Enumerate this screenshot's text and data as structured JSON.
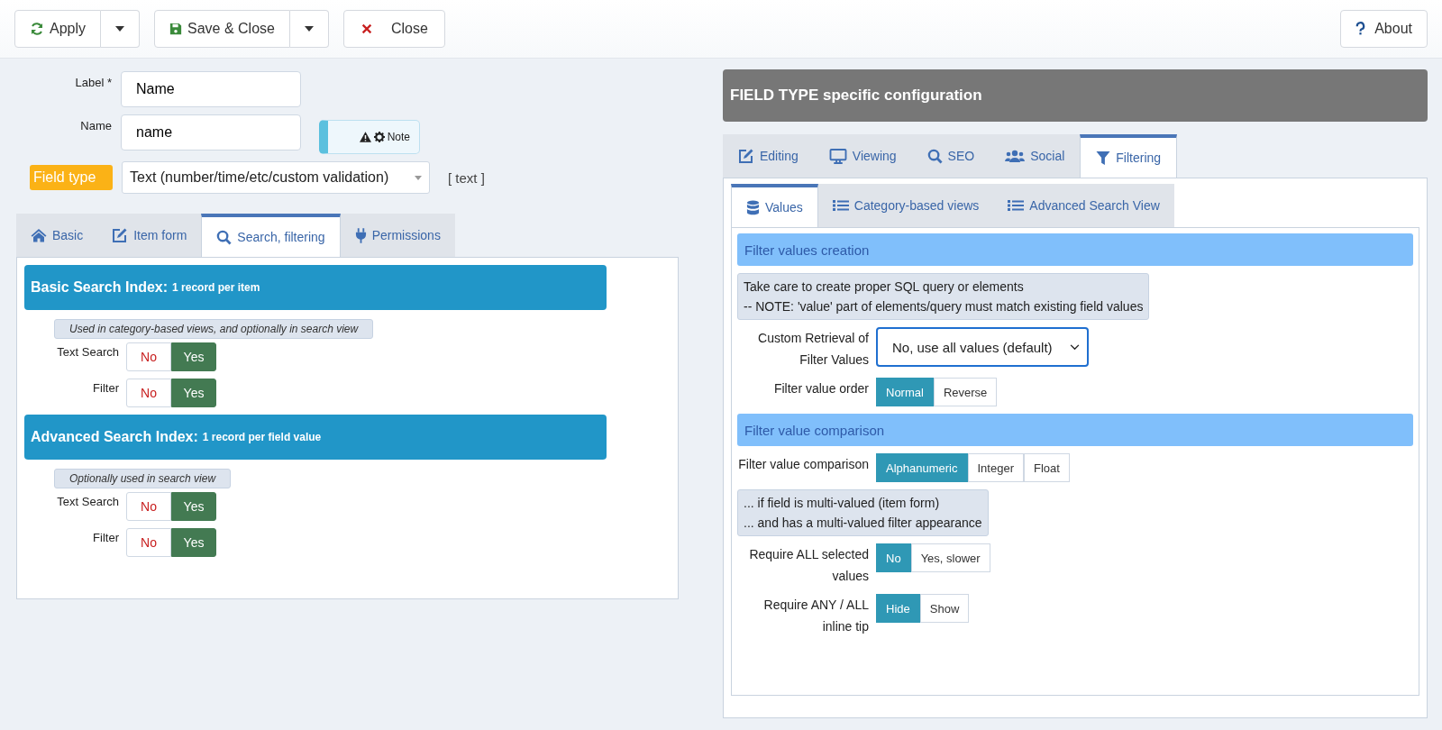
{
  "toolbar": {
    "buttons": [
      {
        "label": "Apply",
        "kind": "refresh",
        "dropdown": true
      },
      {
        "label": "Save & Close",
        "kind": "save",
        "dropdown": true
      },
      {
        "label": "Close",
        "kind": "close",
        "dropdown": false
      }
    ],
    "about": {
      "label": "About",
      "kind": "help"
    }
  },
  "form": {
    "fields": [
      {
        "label": "Label *",
        "value": "Name"
      },
      {
        "label": "Name",
        "value": "name"
      }
    ],
    "note": "Note",
    "field_type": {
      "label": "Field type",
      "value": "Text (number/time/etc/custom validation)",
      "code": "[ text ]"
    }
  },
  "left_tabs": [
    {
      "label": "Basic",
      "kind": "home",
      "selected": false
    },
    {
      "label": "Item form",
      "kind": "edit",
      "selected": false
    },
    {
      "label": "Search, filtering",
      "kind": "search",
      "selected": true
    },
    {
      "label": "Permissions",
      "kind": "plug",
      "selected": false
    }
  ],
  "sections": [
    {
      "title": "Basic Search Index:",
      "subtitle": "1 record per item",
      "hint": "Used in category-based views, and optionally in search view",
      "rows": [
        {
          "label": "Text Search",
          "options": [
            {
              "label": "No",
              "kind": "no",
              "selected": false
            },
            {
              "label": "Yes",
              "kind": "yes",
              "selected": true
            }
          ]
        },
        {
          "label": "Filter",
          "options": [
            {
              "label": "No",
              "kind": "no",
              "selected": false
            },
            {
              "label": "Yes",
              "kind": "yes",
              "selected": true
            }
          ]
        }
      ]
    },
    {
      "title": "Advanced Search Index:",
      "subtitle": "1 record per field value",
      "hint": "Optionally used in search view",
      "rows": [
        {
          "label": "Text Search",
          "options": [
            {
              "label": "No",
              "kind": "no",
              "selected": false
            },
            {
              "label": "Yes",
              "kind": "yes",
              "selected": true
            }
          ]
        },
        {
          "label": "Filter",
          "options": [
            {
              "label": "No",
              "kind": "no",
              "selected": false
            },
            {
              "label": "Yes",
              "kind": "yes",
              "selected": true
            }
          ]
        }
      ]
    }
  ],
  "config": {
    "title": "FIELD TYPE specific configuration",
    "tabs": [
      {
        "label": "Editing",
        "kind": "edit",
        "selected": false
      },
      {
        "label": "Viewing",
        "kind": "desktop",
        "selected": false
      },
      {
        "label": "SEO",
        "kind": "search",
        "selected": false
      },
      {
        "label": "Social",
        "kind": "users",
        "selected": false
      },
      {
        "label": "Filtering",
        "kind": "filter",
        "selected": true
      }
    ],
    "subtabs": [
      {
        "label": "Values",
        "kind": "database",
        "selected": true
      },
      {
        "label": "Category-based views",
        "kind": "list",
        "selected": false
      },
      {
        "label": "Advanced Search View",
        "kind": "list",
        "selected": false
      }
    ],
    "items": [
      {
        "kind": "heading",
        "text": "Filter values creation"
      },
      {
        "kind": "note",
        "lines": [
          "Take care to create proper SQL query or elements",
          "-- NOTE: 'value' part of elements/query must match existing field values"
        ]
      },
      {
        "kind": "select",
        "label": "Custom Retrieval of Filter Values",
        "value": "No, use all values (default)"
      },
      {
        "kind": "radio",
        "label": "Filter value order",
        "options": [
          {
            "label": "Normal",
            "selected": true
          },
          {
            "label": "Reverse",
            "selected": false
          }
        ]
      },
      {
        "kind": "heading",
        "text": "Filter value comparison"
      },
      {
        "kind": "radio",
        "label": "Filter value comparison",
        "options": [
          {
            "label": "Alphanumeric",
            "selected": true
          },
          {
            "label": "Integer",
            "selected": false
          },
          {
            "label": "Float",
            "selected": false
          }
        ]
      },
      {
        "kind": "note",
        "lines": [
          "... if field is multi-valued (item form)",
          "... and has a multi-valued filter appearance"
        ]
      },
      {
        "kind": "radio",
        "label": "Require ALL selected values",
        "options": [
          {
            "label": "No",
            "selected": true
          },
          {
            "label": "Yes, slower",
            "selected": false
          }
        ]
      },
      {
        "kind": "radio",
        "label": "Require ANY / ALL inline tip",
        "options": [
          {
            "label": "Hide",
            "selected": true
          },
          {
            "label": "Show",
            "selected": false
          }
        ]
      }
    ]
  }
}
